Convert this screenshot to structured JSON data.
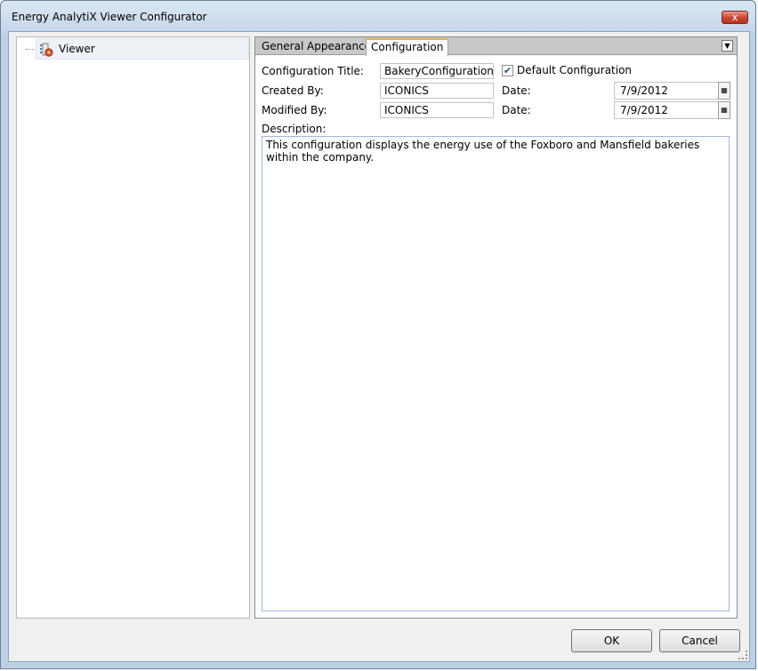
{
  "window": {
    "title": "Energy AnalytiX Viewer Configurator",
    "close_glyph": "x"
  },
  "tree": {
    "root": {
      "label": "Viewer",
      "icon": "viewer-node-icon"
    }
  },
  "tabs": [
    {
      "label": "General",
      "active": false
    },
    {
      "label": "Appearance",
      "active": false
    },
    {
      "label": "Configuration",
      "active": true
    }
  ],
  "tab_menu_icon": "dropdown-arrow-icon",
  "form": {
    "config_title_label": "Configuration Title:",
    "config_title_value": "BakeryConfigurationFM",
    "default_config_label": "Default Configuration",
    "default_config_checked": true,
    "created_by_label": "Created By:",
    "created_by_value": "ICONICS",
    "created_date_label": "Date:",
    "created_date_value": "7/9/2012",
    "modified_by_label": "Modified By:",
    "modified_by_value": "ICONICS",
    "modified_date_label": "Date:",
    "modified_date_value": "7/9/2012",
    "description_label": "Description:",
    "description_value": "This configuration displays the energy use of the Foxboro and Mansfield bakeries within the company."
  },
  "buttons": {
    "ok": "OK",
    "cancel": "Cancel"
  },
  "colors": {
    "active_tab_accent": "#e9b44c",
    "close_button": "#c8452f",
    "window_frame": "#bcd0e6"
  }
}
